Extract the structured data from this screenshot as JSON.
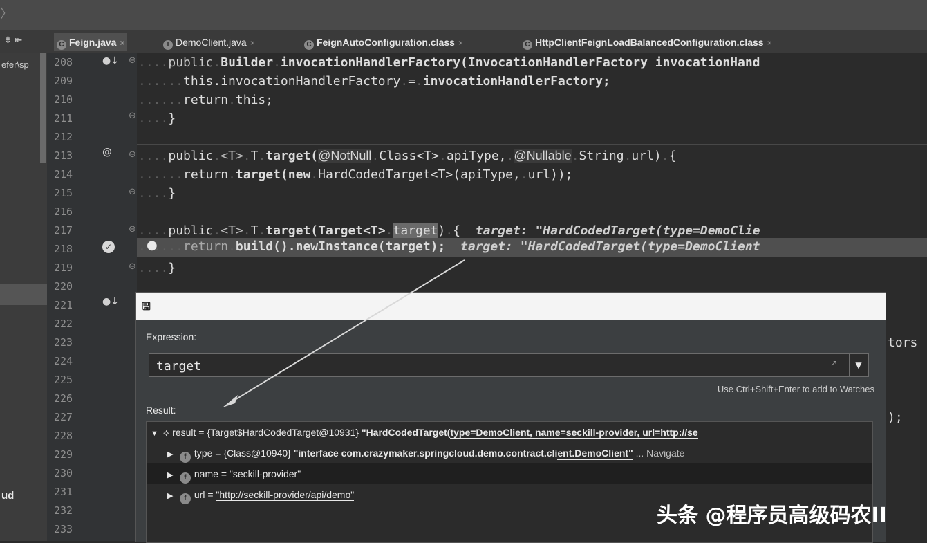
{
  "window": {
    "breadcrumb_fragment": "efer\\sp",
    "bottom_fragment": "ud"
  },
  "tabs": [
    {
      "label": "Feign.java",
      "icon": "class-icon",
      "close": "×",
      "active": true
    },
    {
      "label": "DemoClient.java",
      "icon": "interface-icon",
      "close": "×",
      "active": false
    },
    {
      "label": "FeignAutoConfiguration.class",
      "icon": "class-icon",
      "close": "×",
      "active": false
    },
    {
      "label": "HttpClientFeignLoadBalancedConfiguration.class",
      "icon": "class-icon",
      "close": "×",
      "active": false
    }
  ],
  "gutter": {
    "lines": [
      "208",
      "209",
      "210",
      "211",
      "212",
      "213",
      "214",
      "215",
      "216",
      "217",
      "218",
      "219",
      "220",
      "221",
      "222",
      "223",
      "224",
      "225",
      "226",
      "227",
      "228",
      "229",
      "230",
      "231",
      "232",
      "233"
    ]
  },
  "code": {
    "l208": {
      "a": "public",
      "b": "Builder",
      "c": "invocationHandlerFactory(InvocationHandlerFactory invocationHand"
    },
    "l209": {
      "a": "this.invocationHandlerFactory",
      "b": "=",
      "c": "invocationHandlerFactory;"
    },
    "l210": {
      "a": "return",
      "b": "this;"
    },
    "l211": {
      "a": "}"
    },
    "l213": {
      "a": "public",
      "b": "<T>",
      "c": "T",
      "d": "target(",
      "e": "@NotNull",
      "f": "Class<T>",
      "g": "apiType,",
      "h": "@Nullable",
      "i": "String",
      "j": "url)",
      "k": "{"
    },
    "l214": {
      "a": "return",
      "b": "target(new",
      "c": "HardCodedTarget<T>(apiType,",
      "d": "url));"
    },
    "l215": {
      "a": "}"
    },
    "l217": {
      "a": "public",
      "b": "<T>",
      "c": "T",
      "d": "target(Target<T>",
      "e": "target",
      "f": ")",
      "g": "{",
      "hint": "target: \"HardCodedTarget(type=DemoClie"
    },
    "l218": {
      "a": "return",
      "b": "build().newInstance(target);",
      "hint": "target: \"HardCodedTarget(type=DemoClient"
    },
    "l219": {
      "a": "}"
    },
    "peek223": "tors",
    "peek227": ");"
  },
  "evaluate": {
    "expression_label": "Expression:",
    "expression_value": "target",
    "watch_hint": "Use Ctrl+Shift+Enter to add to Watches",
    "result_label": "Result:",
    "result_row": {
      "prefix": "result = {Target$HardCodedTarget@10931}",
      "value_a": "\"HardCodedTarget(",
      "value_b": "type=DemoClient, name=seckill-provider, url=http://se"
    },
    "type_row": {
      "name": "type",
      "ref": "= {Class@10940}",
      "value_a": "\"interface com.crazymaker.springcloud.demo.contract.cli",
      "value_b": "ent.DemoClient\"",
      "navigate": "... Navigate"
    },
    "name_row": {
      "name": "name",
      "value": "= \"seckill-provider\""
    },
    "url_row": {
      "name": "url",
      "eq": "=",
      "value": "\"http://seckill-provider/api/demo\""
    }
  },
  "watermark": "头条 @程序员高级码农II"
}
